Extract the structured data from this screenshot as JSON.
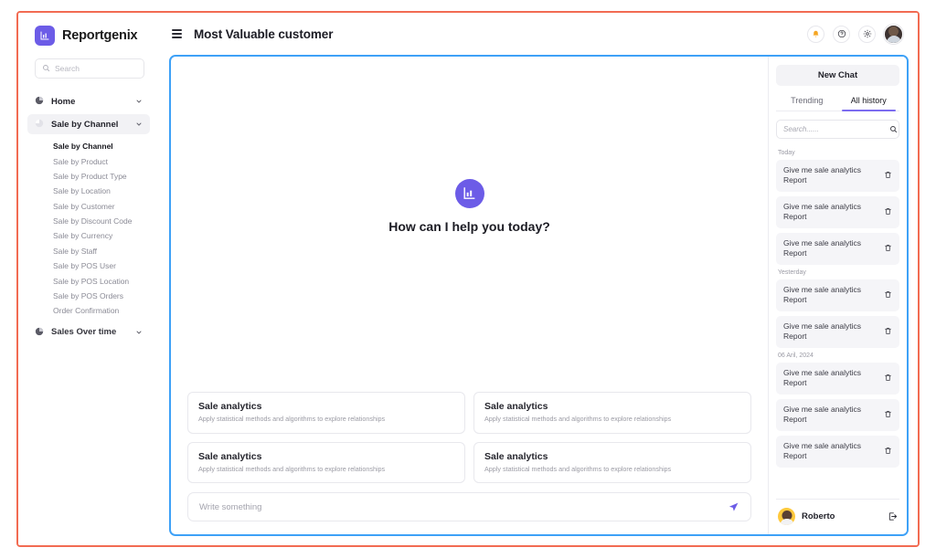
{
  "brand": {
    "name": "Reportgenix",
    "logo_icon": "bar-chart-icon"
  },
  "sidebar": {
    "search": {
      "placeholder": "Search",
      "value": "",
      "icon": "search-icon"
    },
    "groups": [
      {
        "label": "Home",
        "icon": "pie-chart-icon",
        "chevron": "chevron-down-icon",
        "active": false,
        "items": []
      },
      {
        "label": "Sale by Channel",
        "icon": "pie-chart-icon",
        "chevron": "chevron-down-icon",
        "active": true,
        "items": [
          "Sale by Channel",
          "Sale by Product",
          "Sale by Product Type",
          "Sale by Location",
          "Sale by Customer",
          "Sale by Discount Code",
          "Sale by Currency",
          "Sale by Staff",
          "Sale by POS User",
          "Sale by POS Location",
          "Sale by POS Orders",
          "Order Confirmation"
        ],
        "current_item": "Sale by Channel"
      },
      {
        "label": "Sales Over time",
        "icon": "pie-chart-icon",
        "chevron": "chevron-down-icon",
        "active": false,
        "items": []
      }
    ]
  },
  "topbar": {
    "menu_icon": "hamburger-icon",
    "title": "Most Valuable customer",
    "icons": [
      {
        "name": "notification-bell-icon",
        "color": "#f5a623"
      },
      {
        "name": "help-circle-icon",
        "color": "#3c3c44"
      },
      {
        "name": "settings-gear-icon",
        "color": "#3c3c44"
      }
    ],
    "avatar": "user-avatar"
  },
  "chat": {
    "hero_logo_icon": "bar-chart-icon",
    "hero_text": "How can I help you today?",
    "suggestions": [
      {
        "title": "Sale analytics",
        "desc": "Apply statistical methods and algorithms to explore relationships"
      },
      {
        "title": "Sale analytics",
        "desc": "Apply statistical methods and algorithms to explore relationships"
      },
      {
        "title": "Sale analytics",
        "desc": "Apply statistical methods and algorithms to explore relationships"
      },
      {
        "title": "Sale analytics",
        "desc": "Apply statistical methods and algorithms to explore relationships"
      }
    ],
    "composer": {
      "placeholder": "Write something",
      "value": "",
      "send_icon": "send-arrow-icon"
    }
  },
  "history": {
    "new_chat_label": "New Chat",
    "tabs": [
      {
        "label": "Trending",
        "active": false
      },
      {
        "label": "All history",
        "active": true
      }
    ],
    "search": {
      "placeholder": "Search......",
      "value": "",
      "icon": "search-icon"
    },
    "groups": [
      {
        "label": "Today",
        "items": [
          {
            "text": "Give me sale analytics Report",
            "delete_icon": "trash-icon"
          },
          {
            "text": "Give me sale analytics Report",
            "delete_icon": "trash-icon"
          },
          {
            "text": "Give me sale analytics Report",
            "delete_icon": "trash-icon"
          }
        ]
      },
      {
        "label": "Yesterday",
        "items": [
          {
            "text": "Give me sale analytics Report",
            "delete_icon": "trash-icon"
          },
          {
            "text": "Give me sale analytics Report",
            "delete_icon": "trash-icon"
          }
        ]
      },
      {
        "label": "06 Aril, 2024",
        "items": [
          {
            "text": "Give me sale analytics Report",
            "delete_icon": "trash-icon"
          },
          {
            "text": "Give me sale analytics Report",
            "delete_icon": "trash-icon"
          },
          {
            "text": "Give me sale analytics Report",
            "delete_icon": "trash-icon"
          }
        ]
      }
    ],
    "footer": {
      "user_name": "Roberto",
      "avatar": "user-avatar",
      "logout_icon": "logout-icon"
    }
  },
  "colors": {
    "accent_purple": "#6c5ce7",
    "tab_underline": "#7c6cf0",
    "panel_border_blue": "#3ea1f7",
    "frame_red": "#f26b52",
    "bell_orange": "#f5a623"
  }
}
